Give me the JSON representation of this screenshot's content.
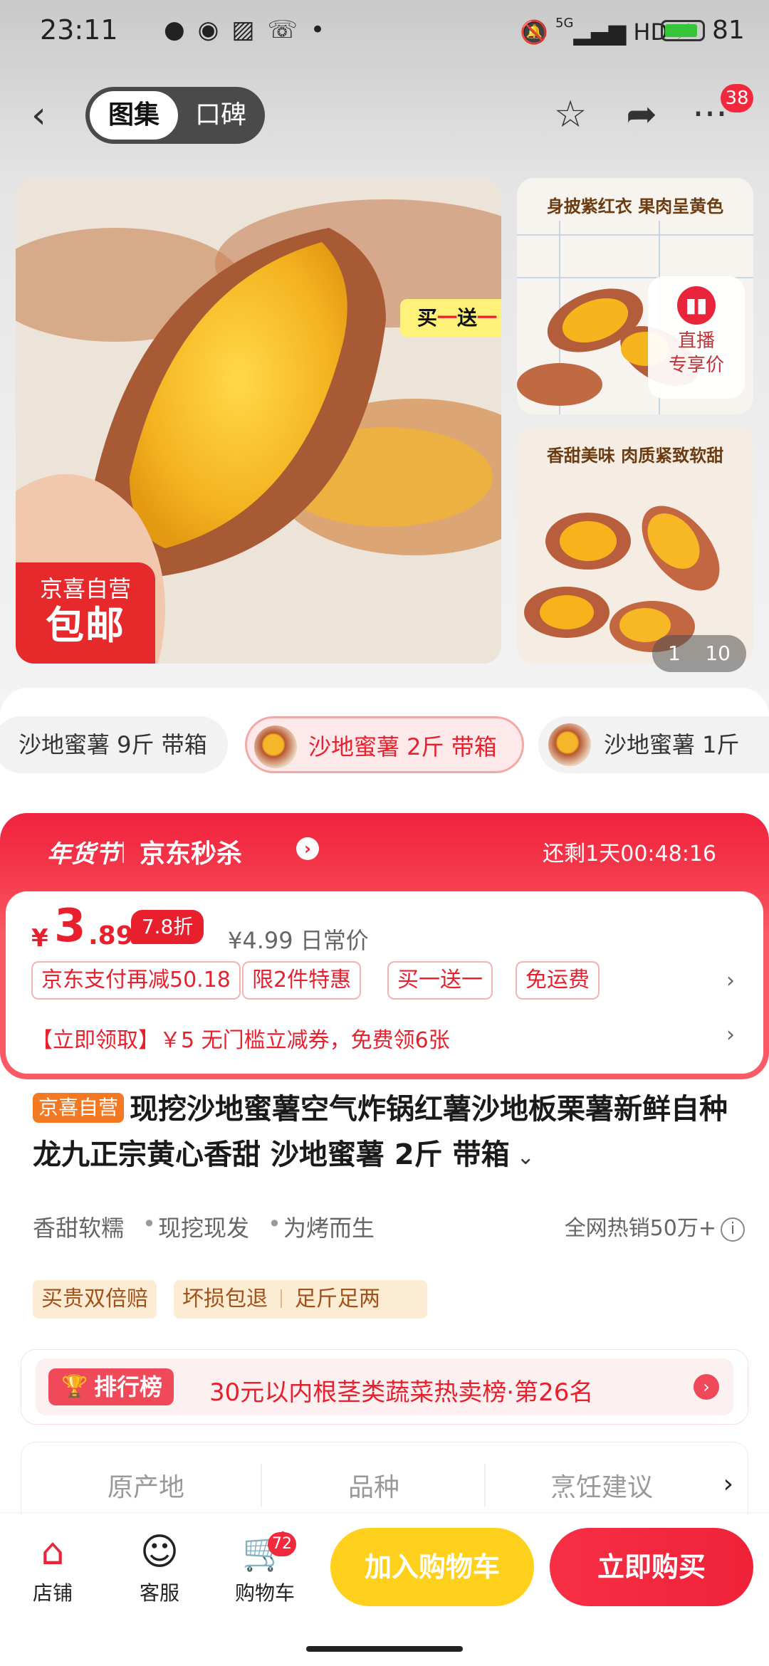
{
  "status_bar": {
    "time": "23:11",
    "left_icons": [
      "chat-bubble-icon",
      "message-icon",
      "image-icon",
      "missed-call-icon",
      "dot-icon"
    ],
    "network": "5G",
    "hd": "HD",
    "battery_level": "81"
  },
  "nav": {
    "tabs": [
      {
        "label": "图集",
        "active": true
      },
      {
        "label": "口碑",
        "active": false
      }
    ],
    "more_badge": "38"
  },
  "gallery": {
    "bogo_tag": {
      "pre": "买",
      "a": "一",
      "mid": "送",
      "b": "一"
    },
    "promo_badge": {
      "line1": "京喜自营",
      "line2": "包邮"
    },
    "thumb1_caption": "身披紫红衣 果肉呈黄色",
    "thumb2_caption": "香甜美味 肉质紧致软甜",
    "live_card": {
      "line1": "直播",
      "line2": "专享价"
    },
    "counter": {
      "current": "1",
      "total": "10"
    }
  },
  "sku_options": [
    {
      "label": "沙地蜜薯 9斤 带箱",
      "selected": false
    },
    {
      "label": "沙地蜜薯 2斤 带箱",
      "selected": true
    },
    {
      "label": "沙地蜜薯 1斤",
      "selected": false
    }
  ],
  "flash_sale": {
    "festival": "年货节",
    "brand": "京东秒杀",
    "countdown": "还剩1天00:48:16",
    "price": {
      "symbol": "¥",
      "integer": "3",
      "decimal": ".89"
    },
    "discount": "7.8折",
    "original_price": "¥4.99 日常价",
    "tags": [
      "京东支付再减50.18",
      "限2件特惠",
      "买一送一",
      "免运费"
    ],
    "coupon": "【立即领取】￥5 无门槛立减券，免费领6张"
  },
  "product": {
    "self_badge": "京喜自营",
    "title": "现挖沙地蜜薯空气炸锅红薯沙地板栗薯新鲜自种龙九正宗黄心香甜 沙地蜜薯 2斤 带箱",
    "features": [
      "香甜软糯",
      "现挖现发",
      "为烤而生"
    ],
    "hot_sales": "全网热销50万+",
    "guarantees": [
      "买贵双倍赔",
      "坏损包退",
      "足斤足两"
    ]
  },
  "ranking": {
    "label": "排行榜",
    "text": "30元以内根茎类蔬菜热卖榜·第26名"
  },
  "attributes": [
    "原产地",
    "品种",
    "烹饪建议"
  ],
  "bottom_bar": {
    "store": "店铺",
    "service": "客服",
    "cart": "购物车",
    "cart_badge": "72",
    "add_to_cart": "加入购物车",
    "buy_now": "立即购买"
  }
}
